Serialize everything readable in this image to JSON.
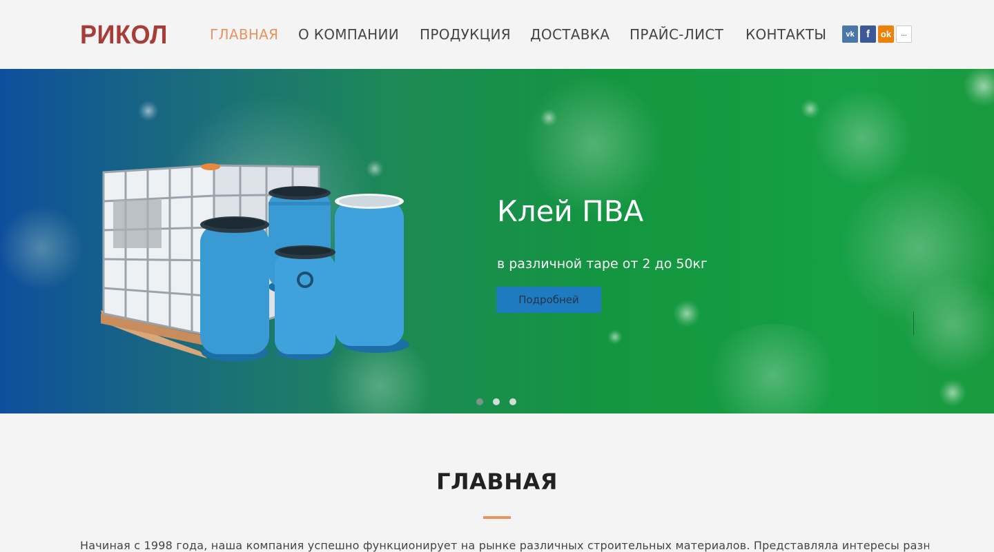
{
  "header": {
    "logo": "РИКОЛ",
    "nav": [
      {
        "label": "ГЛАВНАЯ",
        "active": true
      },
      {
        "label": "О КОМПАНИИ",
        "active": false
      },
      {
        "label": "ПРОДУКЦИЯ",
        "active": false
      },
      {
        "label": "ДОСТАВКА",
        "active": false
      },
      {
        "label": "ПРАЙС-ЛИСТ",
        "active": false
      },
      {
        "label": "КОНТАКТЫ",
        "active": false
      }
    ],
    "social": [
      {
        "icon": "vk-icon",
        "glyph": "vk",
        "color": "#4a76a8"
      },
      {
        "icon": "facebook-icon",
        "glyph": "f",
        "color": "#3b5998"
      },
      {
        "icon": "odnoklassniki-icon",
        "glyph": "ok",
        "color": "#ee8208"
      },
      {
        "icon": "more-icon",
        "glyph": "...",
        "color": "#ffffff"
      }
    ]
  },
  "hero": {
    "title": "Клей ПВА",
    "subtitle": "в различной таре от 2 до 50кг",
    "button": "Подробней",
    "slides_total": 3,
    "active_slide": 1
  },
  "section": {
    "title": "ГЛАВНАЯ",
    "intro": "Начиная с 1998 года, наша компания успешно функционирует на рынке различных строительных материалов. Представляла интересы разных"
  },
  "colors": {
    "accent": "#e79362",
    "logo": "#a83c36",
    "button": "#1f7bbf"
  }
}
